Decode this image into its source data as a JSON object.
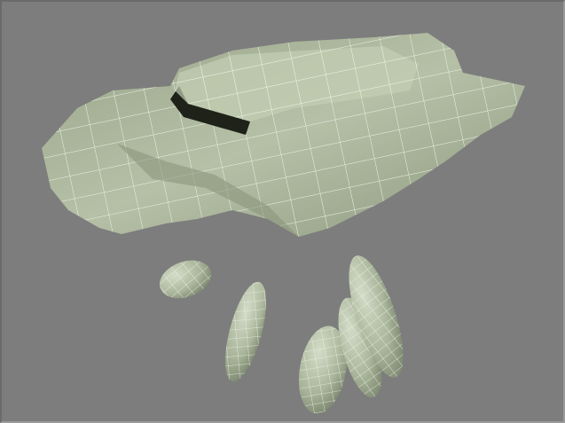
{
  "viewport": {
    "background_color": "#7d7d7d",
    "mesh_color": "#a9b59a",
    "mesh_light_color": "#c9d3bc",
    "mesh_shadow_color": "#7f8a72",
    "wire_color": "#e8ecdf",
    "objects": [
      "terrain-mesh",
      "rock-1",
      "rock-2",
      "rock-3",
      "rock-4",
      "rock-5"
    ]
  }
}
